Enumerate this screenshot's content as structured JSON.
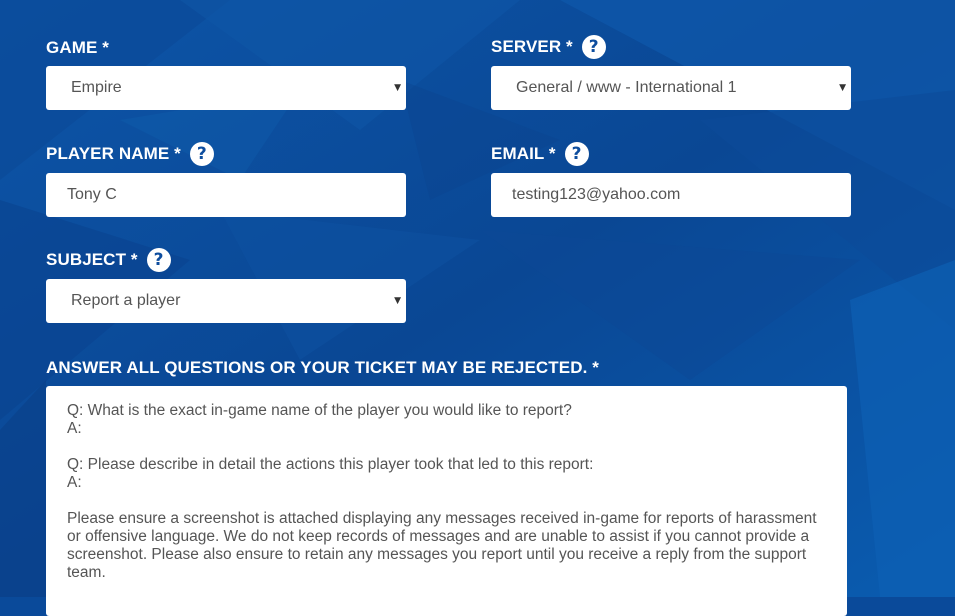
{
  "game": {
    "label": "GAME *",
    "value": "Empire"
  },
  "server": {
    "label": "SERVER *",
    "value": "General / www - International 1"
  },
  "player_name": {
    "label": "PLAYER NAME *",
    "value": "Tony C"
  },
  "email": {
    "label": "EMAIL *",
    "value": "testing123@yahoo.com"
  },
  "subject": {
    "label": "SUBJECT *",
    "value": "Report a player"
  },
  "answers": {
    "label": "ANSWER ALL QUESTIONS OR YOUR TICKET MAY BE REJECTED. *",
    "text": "Q: What is the exact in-game name of the player you would like to report?\nA:\n\nQ: Please describe in detail the actions this player took that led to this report:\nA:\n\nPlease ensure a screenshot is attached displaying any messages received in-game for reports of harassment or offensive language. We do not keep records of messages and are unable to assist if you cannot provide a screenshot. Please also ensure to retain any messages you report until you receive a reply from the support team."
  },
  "icons": {
    "help": "?",
    "caret": "▼"
  },
  "colors": {
    "background": "#0a4a9a",
    "field": "#ffffff",
    "label": "#ffffff",
    "help_icon_fg": "#0d4d9e"
  }
}
